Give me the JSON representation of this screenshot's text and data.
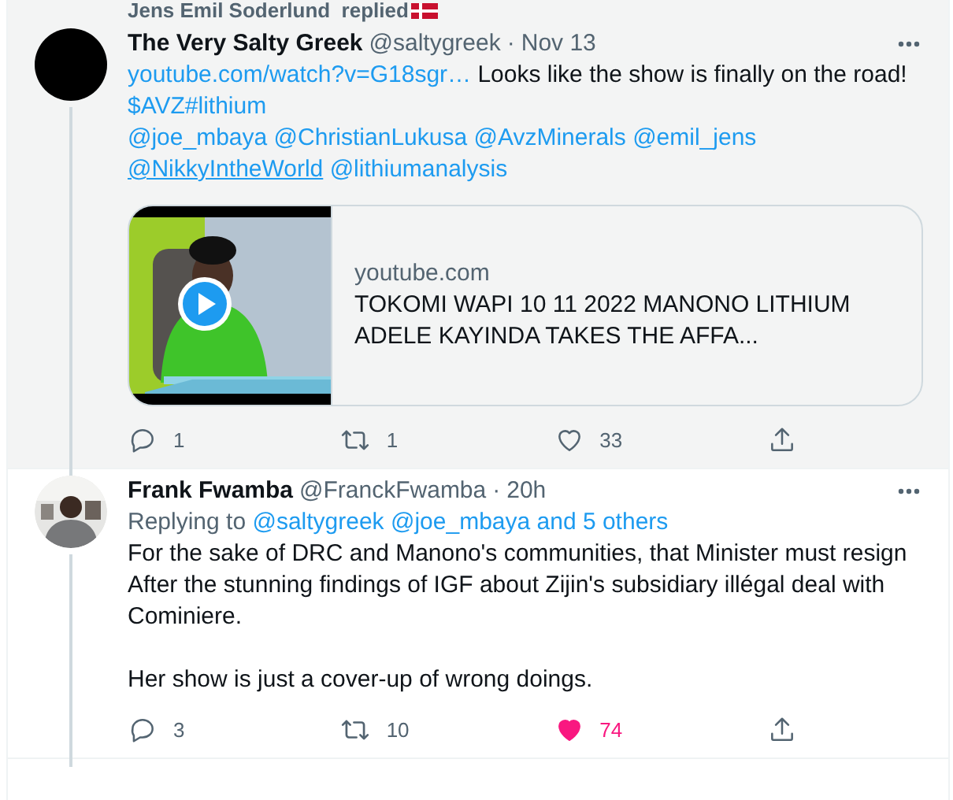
{
  "social_context": {
    "text": "Jens Emil Soderlund  replied"
  },
  "tweets": [
    {
      "name": "The Very Salty Greek",
      "handle": "@saltygreek",
      "separator": "·",
      "time": "Nov 13",
      "avatar": {
        "kind": "plain"
      },
      "hovered": true,
      "thread_line": true,
      "lines": [
        [
          {
            "text": "youtube.com/watch?v=G18sgr…",
            "kind": "link"
          },
          {
            "text": " Looks like the show is finally on the road!",
            "kind": "text"
          }
        ],
        [
          {
            "text": "$AVZ",
            "kind": "link"
          },
          {
            "text": "#lithium",
            "kind": "link",
            "attached": true
          }
        ],
        [
          {
            "text": "@joe_mbaya",
            "kind": "link"
          },
          {
            "text": "@ChristianLukusa",
            "kind": "link"
          },
          {
            "text": "@AvzMinerals",
            "kind": "link"
          },
          {
            "text": "@emil_jens",
            "kind": "link"
          }
        ],
        [
          {
            "text": "@NikkyIntheWorld",
            "kind": "link",
            "underlined": true
          },
          {
            "text": "@lithiumanalysis",
            "kind": "link"
          }
        ]
      ],
      "card": {
        "domain": "youtube.com",
        "title": "TOKOMI WAPI 10 11 2022 MANONO LITHIUM ADELE KAYINDA TAKES THE AFFA..."
      },
      "replies": "1",
      "retweets": "1",
      "likes": "33",
      "liked": false
    },
    {
      "name": "Frank Fwamba",
      "handle": "@FranckFwamba",
      "separator": "·",
      "time": "20h",
      "avatar": {
        "kind": "picture"
      },
      "hovered": false,
      "thread_line": true,
      "replying_to": {
        "label": "Replying to",
        "targets": [
          "@saltygreek",
          "@joe_mbaya",
          "and 5 others"
        ]
      },
      "lines": [
        [
          {
            "text": "For the sake of DRC and Manono's communities, that Minister must resign After the stunning findings of IGF about Zijin's subsidiary illégal deal with Cominiere.",
            "kind": "text"
          }
        ],
        [
          {
            "text": "Her show is just a cover-up of wrong doings.",
            "kind": "text"
          }
        ]
      ],
      "replies": "3",
      "retweets": "10",
      "likes": "74",
      "liked": true
    }
  ]
}
